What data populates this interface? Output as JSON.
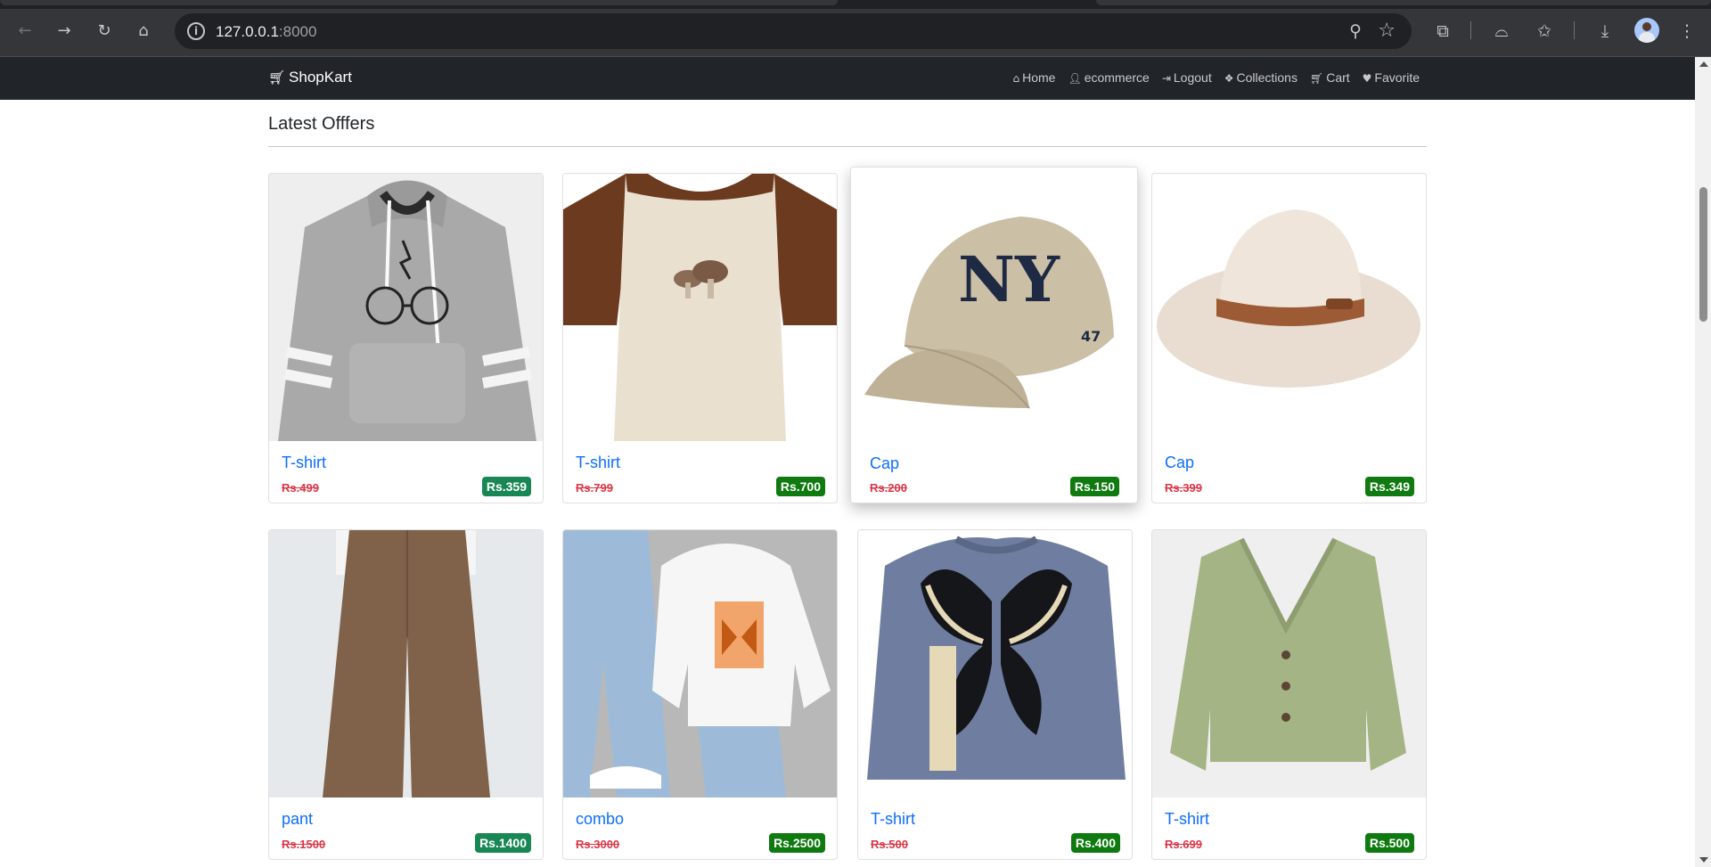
{
  "browser": {
    "url_host": "127.0.0.1",
    "url_port": ":8000",
    "icons": {
      "back": "back-arrow-icon",
      "forward": "forward-arrow-icon",
      "reload": "reload-icon",
      "home": "home-icon",
      "site_info": "site-info-icon",
      "zoom": "zoom-icon",
      "bookmark": "bookmark-star-icon",
      "extensions": "extensions-icon",
      "incognito": "incognito-icon",
      "favorites": "favorites-icon",
      "downloads": "download-icon",
      "menu": "kebab-menu-icon"
    }
  },
  "navbar": {
    "brand": "ShopKart",
    "links": [
      {
        "label": "Home",
        "icon": "home-icon"
      },
      {
        "label": "ecommerce",
        "icon": "user-icon"
      },
      {
        "label": "Logout",
        "icon": "logout-icon"
      },
      {
        "label": "Collections",
        "icon": "cubes-icon"
      },
      {
        "label": "Cart",
        "icon": "cart-icon"
      },
      {
        "label": "Favorite",
        "icon": "heart-icon"
      }
    ]
  },
  "section": {
    "title": "Latest Offfers"
  },
  "products": [
    {
      "name": "T-shirt",
      "old_price": "Rs.499",
      "new_price": "Rs.359",
      "image": "grey-hoodie-glasses-print"
    },
    {
      "name": "T-shirt",
      "old_price": "Rs.799",
      "new_price": "Rs.700",
      "image": "cream-brown-raglan-tee"
    },
    {
      "name": "Cap",
      "old_price": "Rs.200",
      "new_price": "Rs.150",
      "image": "beige-ny-baseball-cap"
    },
    {
      "name": "Cap",
      "old_price": "Rs.399",
      "new_price": "Rs.349",
      "image": "straw-fedora-hat"
    },
    {
      "name": "pant",
      "old_price": "Rs.1500",
      "new_price": "Rs.1400",
      "image": "brown-wide-leg-pant"
    },
    {
      "name": "combo",
      "old_price": "Rs.3000",
      "new_price": "Rs.2500",
      "image": "jeans-hoodie-combo"
    },
    {
      "name": "T-shirt",
      "old_price": "Rs.500",
      "new_price": "Rs.400",
      "image": "blue-butterfly-sweater"
    },
    {
      "name": "T-shirt",
      "old_price": "Rs.699",
      "new_price": "Rs.500",
      "image": "sage-green-cardigan"
    }
  ],
  "colors": {
    "navbar_bg": "#212529",
    "link_blue": "#0d6efd",
    "old_price_red": "#dc3545",
    "price_badge_green": "#198754"
  }
}
